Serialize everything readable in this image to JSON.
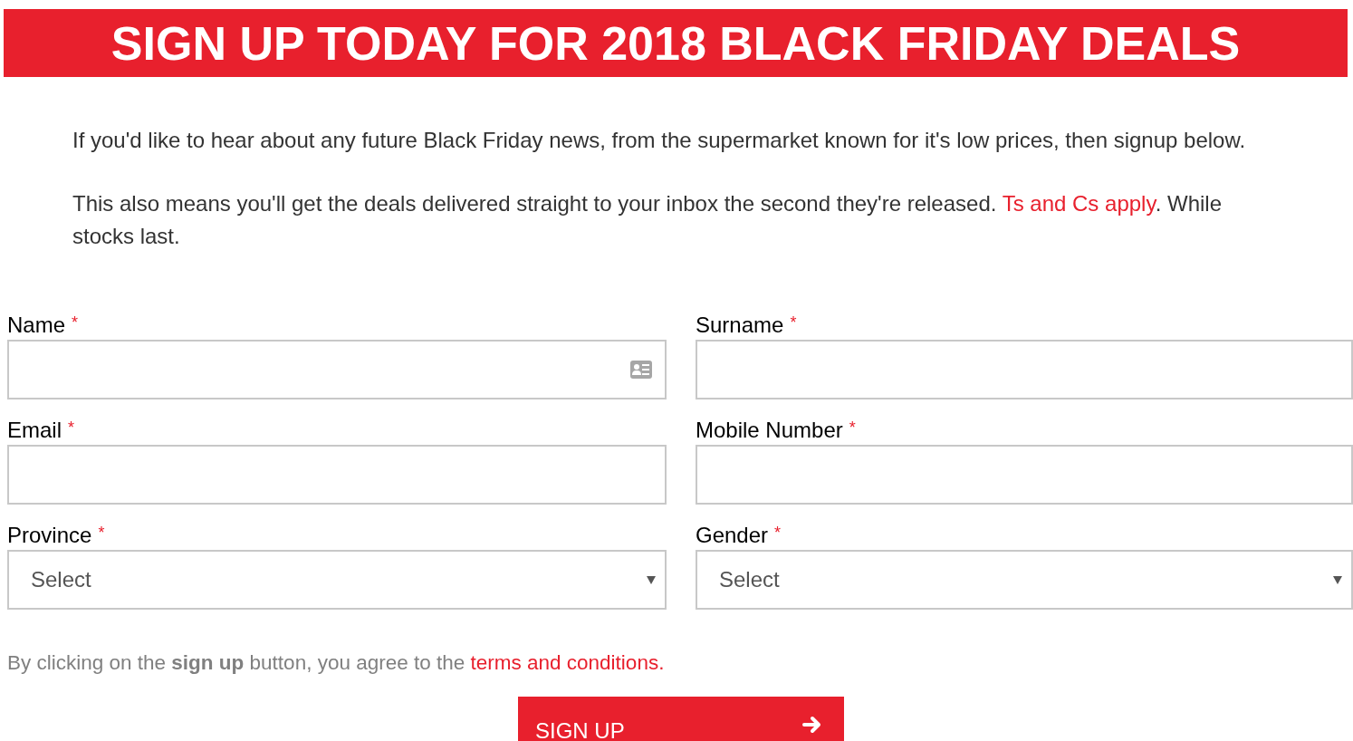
{
  "banner": {
    "title": "SIGN UP TODAY FOR 2018 BLACK FRIDAY DEALS"
  },
  "intro": [
    {
      "text": "If you'd like to hear about any future Black Friday news, from the supermarket known for it's low prices, then signup below."
    },
    {
      "text": "This also means you'll get the deals delivered straight to your inbox the second they're released. ",
      "link": "Ts and Cs apply",
      "after": ". While stocks last."
    }
  ],
  "fields": [
    {
      "label": "Name",
      "required_mark": "*",
      "kind": "text",
      "contact_icon": true
    },
    {
      "label": "Surname",
      "required_mark": "*",
      "kind": "text"
    },
    {
      "label": "Email",
      "required_mark": "*",
      "kind": "text"
    },
    {
      "label": "Mobile Number",
      "required_mark": "*",
      "kind": "text"
    },
    {
      "label": "Province",
      "required_mark": "*",
      "kind": "select",
      "value": "Select"
    },
    {
      "label": "Gender",
      "required_mark": "*",
      "kind": "select",
      "value": "Select"
    }
  ],
  "agreement": {
    "text": "By clicking on the **sign up** button, you agree to the ",
    "link": "terms and conditions."
  },
  "submit": {
    "label": "SIGN UP"
  }
}
